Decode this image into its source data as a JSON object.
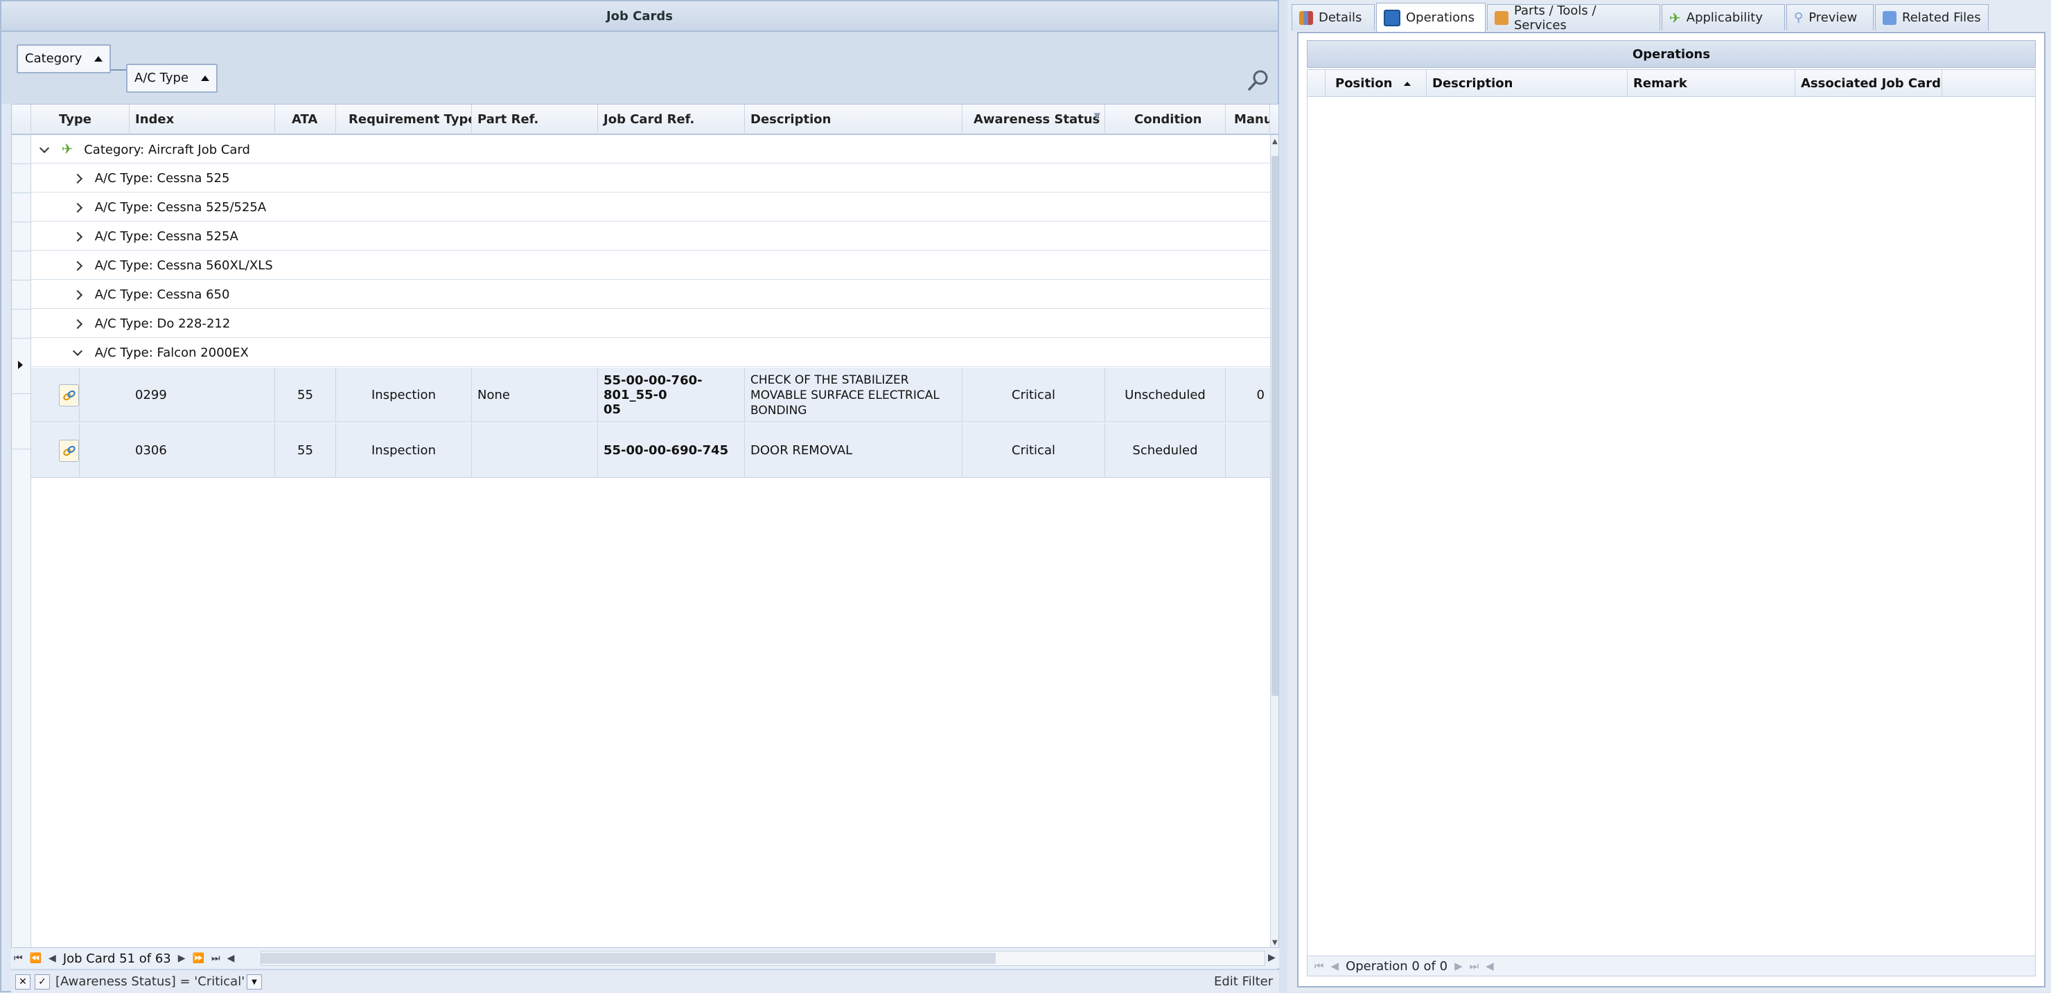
{
  "left": {
    "title": "Job Cards",
    "group_by": [
      "Category",
      "A/C Type"
    ],
    "columns": [
      "Type",
      "Index",
      "ATA",
      "Requirement Type",
      "Part Ref.",
      "Job Card Ref.",
      "Description",
      "Awareness Status",
      "Condition",
      "Manuf. R"
    ],
    "category_row": "Category: Aircraft Job Card",
    "ac_groups": [
      "A/C Type: Cessna 525",
      "A/C Type: Cessna 525/525A",
      "A/C Type: Cessna 525A",
      "A/C Type: Cessna 560XL/XLS",
      "A/C Type: Cessna 650",
      "A/C Type: Do 228-212",
      "A/C Type: Falcon 2000EX"
    ],
    "rows": [
      {
        "index": "0299",
        "ata": "55",
        "requirement_type": "Inspection",
        "part_ref": "None",
        "job_card_ref_l1": "55-00-00-760-801_55-0",
        "job_card_ref_l2": "05",
        "desc_l1": "CHECK OF THE STABILIZER",
        "desc_l2": "MOVABLE SURFACE ELECTRICAL",
        "desc_l3": "BONDING",
        "awareness": "Critical",
        "condition": "Unscheduled",
        "manuf": "0"
      },
      {
        "index": "0306",
        "ata": "55",
        "requirement_type": "Inspection",
        "part_ref": "",
        "job_card_ref_l1": "55-00-00-690-745",
        "job_card_ref_l2": "",
        "desc_l1": "DOOR REMOVAL",
        "desc_l2": "",
        "desc_l3": "",
        "awareness": "Critical",
        "condition": "Scheduled",
        "manuf": ""
      }
    ],
    "navigator": "Job Card 51 of 63",
    "filter_text": "[Awareness Status] = 'Critical'",
    "edit_filter": "Edit Filter"
  },
  "right": {
    "tabs": [
      "Details",
      "Operations",
      "Parts / Tools / Services",
      "Applicability",
      "Preview",
      "Related Files"
    ],
    "active_tab": "Operations",
    "ops_title": "Operations",
    "ops_columns": [
      "Position",
      "Description",
      "Remark",
      "Associated Job Card"
    ],
    "ops_navigator": "Operation 0 of 0"
  },
  "colors": {
    "accent": "#3a6fb0",
    "panel": "#dfe8f4",
    "row_selected": "#e8eef7"
  }
}
